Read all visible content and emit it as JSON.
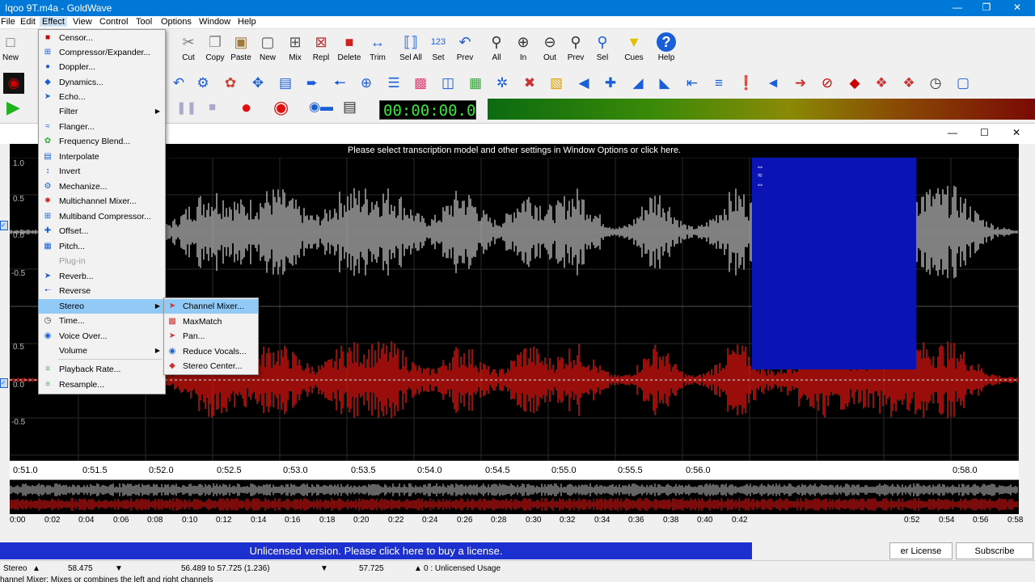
{
  "window": {
    "title": "Iqoo 9T.m4a - GoldWave"
  },
  "menubar": [
    {
      "label": "File"
    },
    {
      "label": "Edit"
    },
    {
      "label": "Effect"
    },
    {
      "label": "View"
    },
    {
      "label": "Control"
    },
    {
      "label": "Tool"
    },
    {
      "label": "Options"
    },
    {
      "label": "Window"
    },
    {
      "label": "Help"
    }
  ],
  "toolbar": {
    "buttons": [
      {
        "label": "New",
        "icon": "new-file-icon"
      },
      {
        "label": "Cut",
        "icon": "scissors-icon"
      },
      {
        "label": "Copy",
        "icon": "copy-icon"
      },
      {
        "label": "Paste",
        "icon": "paste-icon"
      },
      {
        "label": "New",
        "icon": "paste-new-icon"
      },
      {
        "label": "Mix",
        "icon": "mix-icon"
      },
      {
        "label": "Repl",
        "icon": "replace-icon"
      },
      {
        "label": "Delete",
        "icon": "trash-icon"
      },
      {
        "label": "Trim",
        "icon": "trim-icon"
      },
      {
        "label": "Sel All",
        "icon": "select-all-icon"
      },
      {
        "label": "Set",
        "icon": "set-icon"
      },
      {
        "label": "Prev",
        "icon": "prev-selection-icon"
      },
      {
        "label": "All",
        "icon": "zoom-all-icon"
      },
      {
        "label": "In",
        "icon": "zoom-in-icon"
      },
      {
        "label": "Out",
        "icon": "zoom-out-icon"
      },
      {
        "label": "Prev",
        "icon": "zoom-prev-icon"
      },
      {
        "label": "Sel",
        "icon": "zoom-sel-icon"
      },
      {
        "label": "Cues",
        "icon": "cues-icon"
      },
      {
        "label": "Help",
        "icon": "help-icon"
      }
    ]
  },
  "transport": {
    "counter": "00:00:00.0"
  },
  "waveform": {
    "notice": "Please select transcription model and other settings in Window Options or click here.",
    "y_labels": [
      "1.0",
      "0.5",
      "0.0",
      "-0.5",
      "0.5",
      "0.0",
      "-0.5"
    ],
    "time_ticks": [
      "0:51.0",
      "0:51.5",
      "0:52.0",
      "0:52.5",
      "0:53.0",
      "0:53.5",
      "0:54.0",
      "0:54.5",
      "0:55.0",
      "0:55.5",
      "0:56.0",
      "0:58.0"
    ],
    "overview_ticks": [
      "0:00",
      "0:02",
      "0:04",
      "0:06",
      "0:08",
      "0:10",
      "0:12",
      "0:14",
      "0:16",
      "0:18",
      "0:20",
      "0:22",
      "0:24",
      "0:26",
      "0:28",
      "0:30",
      "0:32",
      "0:34",
      "0:36",
      "0:38",
      "0:40",
      "0:42",
      "0:52",
      "0:54",
      "0:56",
      "0:58"
    ]
  },
  "effect_menu": {
    "items": [
      {
        "label": "Censor...",
        "icon": "censor-icon",
        "submenu": false
      },
      {
        "label": "Compressor/Expander...",
        "icon": "compressor-icon",
        "submenu": false
      },
      {
        "label": "Doppler...",
        "icon": "doppler-icon",
        "submenu": false
      },
      {
        "label": "Dynamics...",
        "icon": "dynamics-icon",
        "submenu": false
      },
      {
        "label": "Echo...",
        "icon": "echo-icon",
        "submenu": false
      },
      {
        "label": "Filter",
        "icon": "",
        "submenu": true
      },
      {
        "label": "Flanger...",
        "icon": "flanger-icon",
        "submenu": false
      },
      {
        "label": "Frequency Blend...",
        "icon": "frequency-blend-icon",
        "submenu": false
      },
      {
        "label": "Interpolate",
        "icon": "interpolate-icon",
        "submenu": false
      },
      {
        "label": "Invert",
        "icon": "invert-icon",
        "submenu": false
      },
      {
        "label": "Mechanize...",
        "icon": "mechanize-icon",
        "submenu": false
      },
      {
        "label": "Multichannel Mixer...",
        "icon": "multichannel-mixer-icon",
        "submenu": false
      },
      {
        "label": "Multiband Compressor...",
        "icon": "multiband-compressor-icon",
        "submenu": false
      },
      {
        "label": "Offset...",
        "icon": "offset-icon",
        "submenu": false
      },
      {
        "label": "Pitch...",
        "icon": "pitch-icon",
        "submenu": false
      },
      {
        "label": "Plug-in",
        "icon": "",
        "submenu": false,
        "disabled": true
      },
      {
        "label": "Reverb...",
        "icon": "reverb-icon",
        "submenu": false
      },
      {
        "label": "Reverse",
        "icon": "reverse-icon",
        "submenu": false
      },
      {
        "label": "Stereo",
        "icon": "",
        "submenu": true,
        "highlighted": true
      },
      {
        "label": "Time...",
        "icon": "time-icon",
        "submenu": false
      },
      {
        "label": "Voice Over...",
        "icon": "voice-over-icon",
        "submenu": false
      },
      {
        "label": "Volume",
        "icon": "",
        "submenu": true
      },
      {
        "label": "Playback Rate...",
        "icon": "playback-rate-icon",
        "submenu": false
      },
      {
        "label": "Resample...",
        "icon": "resample-icon",
        "submenu": false
      }
    ]
  },
  "stereo_menu": {
    "items": [
      {
        "label": "Channel Mixer...",
        "icon": "channel-mixer-icon",
        "highlighted": true
      },
      {
        "label": "MaxMatch",
        "icon": "maxmatch-icon"
      },
      {
        "label": "Pan...",
        "icon": "pan-icon"
      },
      {
        "label": "Reduce Vocals...",
        "icon": "reduce-vocals-icon"
      },
      {
        "label": "Stereo Center...",
        "icon": "stereo-center-icon"
      }
    ]
  },
  "license": {
    "text": "Unlicensed version. Please click here to buy a license.",
    "buy_label": "er License",
    "subscribe_label": "Subscribe"
  },
  "status": {
    "channels": "Stereo",
    "length": "58.475",
    "selection": "56.489 to 57.725 (1.236)",
    "position": "57.725",
    "usage": "0 : Unlicensed Usage",
    "hint": "hannel Mixer: Mixes or combines the left and right channels"
  },
  "colors": {
    "titlebar": "#0078d7",
    "waveform_top": "#a0a0a0",
    "waveform_bottom": "#c0120c",
    "selection": "#0a14b4",
    "license_bar": "#1c2fcf",
    "counter": "#36e836"
  }
}
